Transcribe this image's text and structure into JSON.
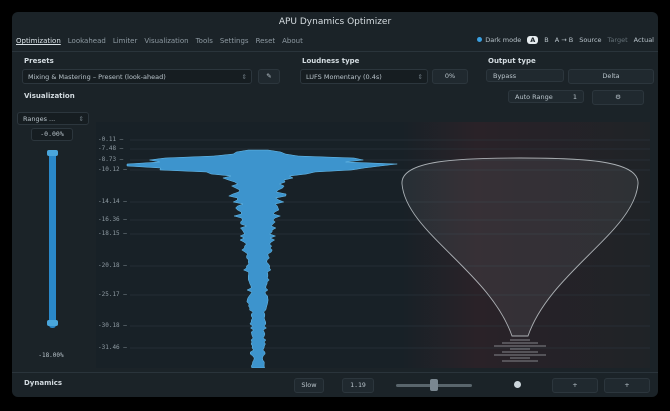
{
  "app": {
    "title": "APU Dynamics Optimizer"
  },
  "menu": [
    {
      "label": "Optimization",
      "active": true
    },
    {
      "label": "Lookahead",
      "active": false
    },
    {
      "label": "Limiter",
      "active": false
    },
    {
      "label": "Visualization",
      "active": false
    },
    {
      "label": "Tools",
      "active": false
    },
    {
      "label": "Settings",
      "active": false
    },
    {
      "label": "Reset",
      "active": false
    },
    {
      "label": "About",
      "active": false
    }
  ],
  "top_right": {
    "mode_label": "Dark mode",
    "a_label": "A",
    "b_label": "B",
    "ab_arrow": "A → B",
    "source": "Source",
    "target": "Target",
    "actual": "Actual"
  },
  "presets": {
    "heading": "Presets",
    "value": "Mixing & Mastering – Present (look-ahead)"
  },
  "loudness": {
    "heading": "Loudness type",
    "value": "LUFS Momentary (0.4s)",
    "extra": "0%"
  },
  "output": {
    "heading": "Output type",
    "options": [
      "Bypass",
      "Delta"
    ]
  },
  "visualization": {
    "heading": "Visualization",
    "auto_range_label": "Auto Range",
    "auto_range_value": "1"
  },
  "left_panel": {
    "ranges_label": "Ranges ...",
    "top_value": "-0.00%",
    "bottom_value": "-18.00%"
  },
  "axis_ticks": [
    "-0.11",
    "-7.48",
    "-8.73",
    "-10.12",
    "-14.14",
    "-16.36",
    "-18.15",
    "-20.18",
    "-25.17",
    "-30.18",
    "-31.46"
  ],
  "bottom": {
    "heading": "Dynamics",
    "slow_label": "Slow",
    "value": "1.19",
    "slider_level": 0.5,
    "buttons": [
      "+",
      "+"
    ]
  },
  "colors": {
    "accent": "#3a9fe0",
    "waveform": "#4aa6dc",
    "ghost": "#d7dde1"
  }
}
